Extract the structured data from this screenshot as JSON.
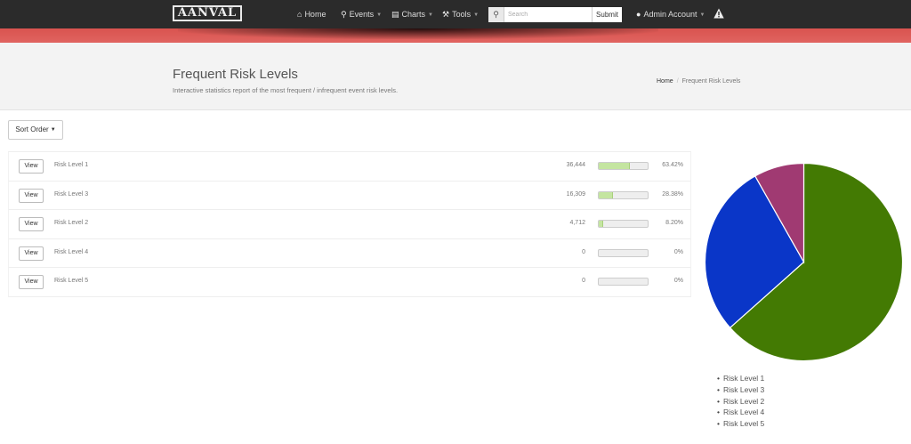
{
  "navbar": {
    "logo": "AANVAL",
    "items": [
      {
        "label": "Home",
        "icon": "home-icon",
        "has_caret": false
      },
      {
        "label": "Events",
        "icon": "search-icon",
        "has_caret": true
      },
      {
        "label": "Charts",
        "icon": "bar-chart-icon",
        "has_caret": true
      },
      {
        "label": "Tools",
        "icon": "wrench-icon",
        "has_caret": true
      }
    ],
    "search": {
      "placeholder": "Search",
      "submit_label": "Submit"
    },
    "account": {
      "label": "Admin Account",
      "icon": "user-icon"
    },
    "alert_icon": "warning-icon",
    "accent_color": "#d9534f"
  },
  "header": {
    "title": "Frequent Risk Levels",
    "subtitle": "Interactive statistics report of the most frequent / infrequent event risk levels.",
    "breadcrumb": {
      "home": "Home",
      "current": "Frequent Risk Levels"
    }
  },
  "controls": {
    "sort_label": "Sort Order"
  },
  "rows": [
    {
      "view_label": "View",
      "name": "Risk Level 1",
      "count": "36,444",
      "percent_label": "63.42%",
      "percent": 63.42
    },
    {
      "view_label": "View",
      "name": "Risk Level 3",
      "count": "16,309",
      "percent_label": "28.38%",
      "percent": 28.38
    },
    {
      "view_label": "View",
      "name": "Risk Level 2",
      "count": "4,712",
      "percent_label": "8.20%",
      "percent": 8.2
    },
    {
      "view_label": "View",
      "name": "Risk Level 4",
      "count": "0",
      "percent_label": "0%",
      "percent": 0
    },
    {
      "view_label": "View",
      "name": "Risk Level 5",
      "count": "0",
      "percent_label": "0%",
      "percent": 0
    }
  ],
  "chart_data": {
    "type": "pie",
    "categories": [
      "Risk Level 1",
      "Risk Level 3",
      "Risk Level 2",
      "Risk Level 4",
      "Risk Level 5"
    ],
    "values": [
      63.42,
      28.38,
      8.2,
      0,
      0
    ],
    "colors": [
      "#437a03",
      "#0a36c8",
      "#a03a72",
      "#cccccc",
      "#999999"
    ],
    "legend": "bottom"
  }
}
